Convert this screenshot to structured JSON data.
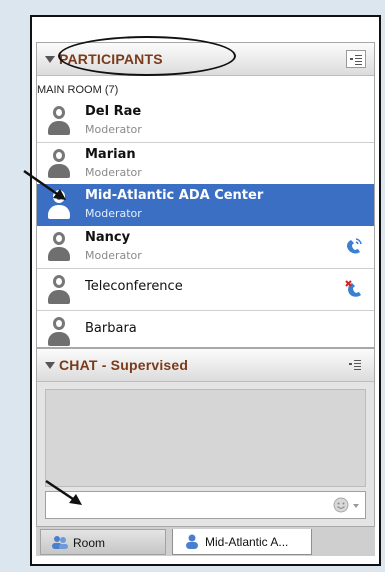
{
  "participants": {
    "title": "PARTICIPANTS",
    "room_label": "MAIN ROOM (7)",
    "items": [
      {
        "name": "Del Rae",
        "role": "Moderator",
        "selected": false,
        "status_icon": ""
      },
      {
        "name": "Marian",
        "role": "Moderator",
        "selected": false,
        "status_icon": ""
      },
      {
        "name": "Mid-Atlantic ADA Center",
        "role": "Moderator",
        "selected": true,
        "status_icon": ""
      },
      {
        "name": "Nancy",
        "role": "Moderator",
        "selected": false,
        "status_icon": "phone-connected-icon"
      },
      {
        "name": "Teleconference",
        "role": "",
        "selected": false,
        "status_icon": "phone-muted-icon"
      },
      {
        "name": "Barbara",
        "role": "",
        "selected": false,
        "status_icon": ""
      }
    ]
  },
  "chat": {
    "title": "CHAT - Supervised",
    "input_value": ""
  },
  "tabs": [
    {
      "label": "Room",
      "active": false,
      "icon": "group-icon"
    },
    {
      "label": "Mid-Atlantic A...",
      "active": true,
      "icon": "user-icon"
    }
  ],
  "colors": {
    "header_text": "#7a3b1a",
    "selection": "#3a6fc4",
    "role_text": "#8a8a8a"
  }
}
